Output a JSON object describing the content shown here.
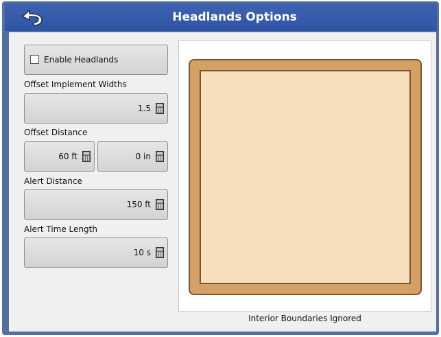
{
  "header": {
    "title": "Headlands Options",
    "back_icon": "back-arrow-icon"
  },
  "controls": {
    "enable_headlands_label": "Enable Headlands",
    "enable_headlands_checked": false,
    "offset_implement_widths": {
      "label": "Offset Implement Widths",
      "value": "1.5"
    },
    "offset_distance": {
      "label": "Offset Distance",
      "feet_value": "60 ft",
      "inches_value": "0 in"
    },
    "alert_distance": {
      "label": "Alert Distance",
      "value": "150 ft"
    },
    "alert_time_length": {
      "label": "Alert Time Length",
      "value": "10 s"
    },
    "calculator_icon": "calculator-icon"
  },
  "preview": {
    "caption": "Interior Boundaries Ignored"
  },
  "colors": {
    "title_bar": "#3e63b0",
    "frame": "#5470a0",
    "field_border": "#d4a165",
    "field_fill": "#f6dfba"
  }
}
